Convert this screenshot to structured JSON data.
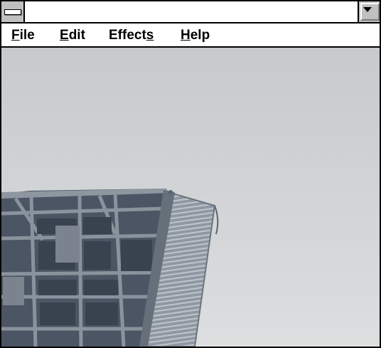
{
  "window": {
    "title": "",
    "system_menu_icon": "system-menu-icon",
    "dropdown_icon": "chevron-down-icon"
  },
  "menubar": {
    "items": [
      {
        "pre": "",
        "mnemonic": "F",
        "post": "ile"
      },
      {
        "pre": "",
        "mnemonic": "E",
        "post": "dit"
      },
      {
        "pre": "Effect",
        "mnemonic": "s",
        "post": ""
      },
      {
        "pre": "",
        "mnemonic": "H",
        "post": "elp"
      }
    ]
  },
  "image": {
    "subject": "grayscale photograph",
    "sky_color": "#cfd2d4",
    "structure_color": "#4b5563"
  }
}
